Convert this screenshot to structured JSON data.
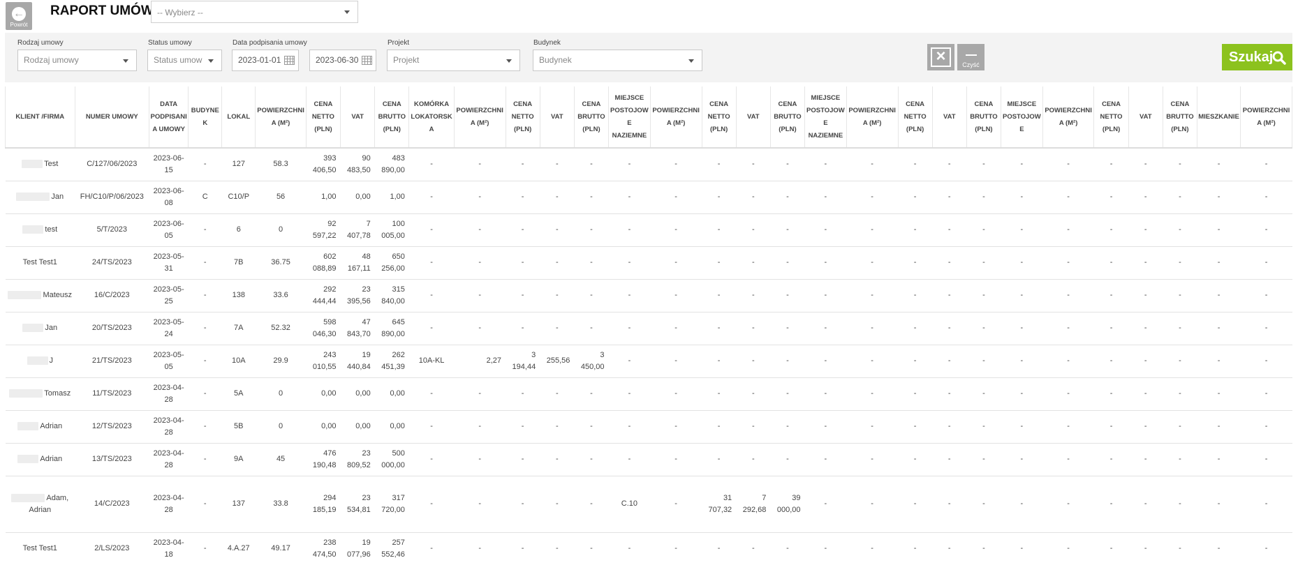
{
  "back_button": {
    "label": "Powrót"
  },
  "page_title": "RAPORT UMÓW",
  "header_select": {
    "placeholder": "-- Wybierz --"
  },
  "filters": {
    "contract_type": {
      "label": "Rodzaj umowy",
      "placeholder": "Rodzaj umowy"
    },
    "status": {
      "label": "Status umowy",
      "placeholder": "Status umow"
    },
    "signing_date": {
      "label": "Data podpisania umowy",
      "from": "2023-01-01",
      "to": "2023-06-30"
    },
    "project": {
      "label": "Projekt",
      "placeholder": "Projekt"
    },
    "building": {
      "label": "Budynek",
      "placeholder": "Budynek"
    }
  },
  "buttons": {
    "clear_label": "Czyść",
    "search_label": "Szukaj"
  },
  "table": {
    "columns": [
      "KLIENT /FIRMA",
      "NUMER UMOWY",
      "DATA PODPISANIA UMOWY",
      "BUDYNEK",
      "LOKAL",
      "POWIERZCHNIA (M²)",
      "CENA NETTO (PLN)",
      "VAT",
      "CENA BRUTTO (PLN)",
      "KOMÓRKA LOKATORSKA",
      "POWIERZCHNIA (M²)",
      "CENA NETTO (PLN)",
      "VAT",
      "CENA BRUTTO (PLN)",
      "MIEJSCE POSTOJOWE NAZIEMNE",
      "POWIERZCHNIA (M²)",
      "CENA NETTO (PLN)",
      "VAT",
      "CENA BRUTTO (PLN)",
      "MIEJSCE POSTOJOWE NAZIEMNE",
      "POWIERZCHNIA (M²)",
      "CENA NETTO (PLN)",
      "VAT",
      "CENA BRUTTO (PLN)",
      "MIEJSCE POSTOJOWE",
      "POWIERZCHNIA (M²)",
      "CENA NETTO (PLN)",
      "VAT",
      "CENA BRUTTO (PLN)",
      "MIESZKANIE",
      "POWIERZCHNIA (M²)"
    ],
    "rows": [
      {
        "client": "Test",
        "number": "C/127/06/2023",
        "date": "2023-06-15",
        "building": "-",
        "unit": "127",
        "area": "58.3",
        "net": "393 406,50",
        "vat": "90 483,50",
        "gross": "483 890,00",
        "extra": [
          "-",
          "-",
          "-",
          "-",
          "-",
          "-",
          "-",
          "-",
          "-",
          "-",
          "-",
          "-",
          "-",
          "-",
          "-",
          "-",
          "-",
          "-",
          "-",
          "-",
          "-",
          "-"
        ]
      },
      {
        "client": "Jan",
        "number": "FH/C10/P/06/2023",
        "date": "2023-06-08",
        "building": "C",
        "unit": "C10/P",
        "area": "56",
        "net": "1,00",
        "vat": "0,00",
        "gross": "1,00",
        "extra": [
          "-",
          "-",
          "-",
          "-",
          "-",
          "-",
          "-",
          "-",
          "-",
          "-",
          "-",
          "-",
          "-",
          "-",
          "-",
          "-",
          "-",
          "-",
          "-",
          "-",
          "-",
          "-"
        ]
      },
      {
        "client": "test",
        "number": "5/T/2023",
        "date": "2023-06-05",
        "building": "-",
        "unit": "6",
        "area": "0",
        "net": "92 597,22",
        "vat": "7 407,78",
        "gross": "100 005,00",
        "extra": [
          "-",
          "-",
          "-",
          "-",
          "-",
          "-",
          "-",
          "-",
          "-",
          "-",
          "-",
          "-",
          "-",
          "-",
          "-",
          "-",
          "-",
          "-",
          "-",
          "-",
          "-",
          "-"
        ]
      },
      {
        "client": "Test Test1",
        "number": "24/TS/2023",
        "date": "2023-05-31",
        "building": "-",
        "unit": "7B",
        "area": "36.75",
        "net": "602 088,89",
        "vat": "48 167,11",
        "gross": "650 256,00",
        "extra": [
          "-",
          "-",
          "-",
          "-",
          "-",
          "-",
          "-",
          "-",
          "-",
          "-",
          "-",
          "-",
          "-",
          "-",
          "-",
          "-",
          "-",
          "-",
          "-",
          "-",
          "-",
          "-"
        ]
      },
      {
        "client": "Mateusz",
        "number": "16/C/2023",
        "date": "2023-05-25",
        "building": "-",
        "unit": "138",
        "area": "33.6",
        "net": "292 444,44",
        "vat": "23 395,56",
        "gross": "315 840,00",
        "extra": [
          "-",
          "-",
          "-",
          "-",
          "-",
          "-",
          "-",
          "-",
          "-",
          "-",
          "-",
          "-",
          "-",
          "-",
          "-",
          "-",
          "-",
          "-",
          "-",
          "-",
          "-",
          "-"
        ]
      },
      {
        "client": "Jan",
        "number": "20/TS/2023",
        "date": "2023-05-24",
        "building": "-",
        "unit": "7A",
        "area": "52.32",
        "net": "598 046,30",
        "vat": "47 843,70",
        "gross": "645 890,00",
        "extra": [
          "-",
          "-",
          "-",
          "-",
          "-",
          "-",
          "-",
          "-",
          "-",
          "-",
          "-",
          "-",
          "-",
          "-",
          "-",
          "-",
          "-",
          "-",
          "-",
          "-",
          "-",
          "-"
        ]
      },
      {
        "client": "J",
        "number": "21/TS/2023",
        "date": "2023-05-05",
        "building": "-",
        "unit": "10A",
        "area": "29.9",
        "net": "243 010,55",
        "vat": "19 440,84",
        "gross": "262 451,39",
        "extra": [
          "10A-KL",
          "2,27",
          "3 194,44",
          "255,56",
          "3 450,00",
          "-",
          "-",
          "-",
          "-",
          "-",
          "-",
          "-",
          "-",
          "-",
          "-",
          "-",
          "-",
          "-",
          "-",
          "-",
          "-",
          "-"
        ]
      },
      {
        "client": "Tomasz",
        "number": "11/TS/2023",
        "date": "2023-04-28",
        "building": "-",
        "unit": "5A",
        "area": "0",
        "net": "0,00",
        "vat": "0,00",
        "gross": "0,00",
        "extra": [
          "-",
          "-",
          "-",
          "-",
          "-",
          "-",
          "-",
          "-",
          "-",
          "-",
          "-",
          "-",
          "-",
          "-",
          "-",
          "-",
          "-",
          "-",
          "-",
          "-",
          "-",
          "-"
        ]
      },
      {
        "client": "Adrian",
        "number": "12/TS/2023",
        "date": "2023-04-28",
        "building": "-",
        "unit": "5B",
        "area": "0",
        "net": "0,00",
        "vat": "0,00",
        "gross": "0,00",
        "extra": [
          "-",
          "-",
          "-",
          "-",
          "-",
          "-",
          "-",
          "-",
          "-",
          "-",
          "-",
          "-",
          "-",
          "-",
          "-",
          "-",
          "-",
          "-",
          "-",
          "-",
          "-",
          "-"
        ]
      },
      {
        "client": "Adrian",
        "number": "13/TS/2023",
        "date": "2023-04-28",
        "building": "-",
        "unit": "9A",
        "area": "45",
        "net": "476 190,48",
        "vat": "23 809,52",
        "gross": "500 000,00",
        "extra": [
          "-",
          "-",
          "-",
          "-",
          "-",
          "-",
          "-",
          "-",
          "-",
          "-",
          "-",
          "-",
          "-",
          "-",
          "-",
          "-",
          "-",
          "-",
          "-",
          "-",
          "-",
          "-"
        ]
      },
      {
        "client": "Adam, Adrian",
        "number": "14/C/2023",
        "date": "2023-04-28",
        "building": "-",
        "unit": "137",
        "area": "33.8",
        "net": "294 185,19",
        "vat": "23 534,81",
        "gross": "317 720,00",
        "extra": [
          "-",
          "-",
          "-",
          "-",
          "-",
          "C.10",
          "-",
          "31 707,32",
          "7 292,68",
          "39 000,00",
          "-",
          "-",
          "-",
          "-",
          "-",
          "-",
          "-",
          "-",
          "-",
          "-",
          "-",
          "-"
        ]
      },
      {
        "client": "Test Test1",
        "number": "2/LS/2023",
        "date": "2023-04-18",
        "building": "-",
        "unit": "4.A.27",
        "area": "49.17",
        "net": "238 474,50",
        "vat": "19 077,96",
        "gross": "257 552,46",
        "extra": [
          "-",
          "-",
          "-",
          "-",
          "-",
          "-",
          "-",
          "-",
          "-",
          "-",
          "-",
          "-",
          "-",
          "-",
          "-",
          "-",
          "-",
          "-",
          "-",
          "-",
          "-",
          "-"
        ]
      }
    ]
  }
}
